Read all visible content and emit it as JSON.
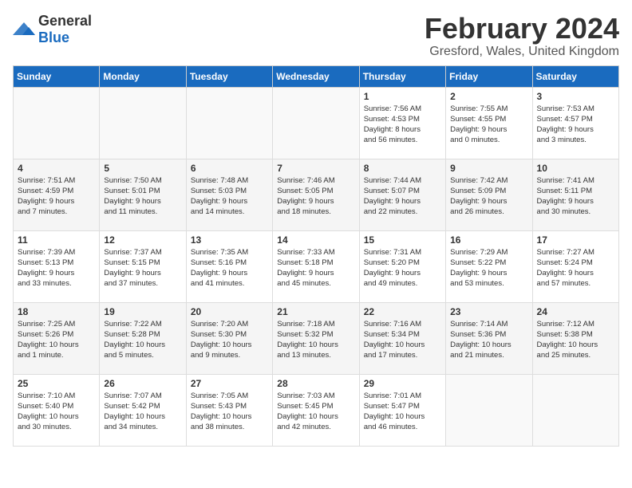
{
  "logo": {
    "general": "General",
    "blue": "Blue"
  },
  "title": "February 2024",
  "location": "Gresford, Wales, United Kingdom",
  "headers": [
    "Sunday",
    "Monday",
    "Tuesday",
    "Wednesday",
    "Thursday",
    "Friday",
    "Saturday"
  ],
  "rows": [
    [
      {
        "day": "",
        "info": ""
      },
      {
        "day": "",
        "info": ""
      },
      {
        "day": "",
        "info": ""
      },
      {
        "day": "",
        "info": ""
      },
      {
        "day": "1",
        "info": "Sunrise: 7:56 AM\nSunset: 4:53 PM\nDaylight: 8 hours\nand 56 minutes."
      },
      {
        "day": "2",
        "info": "Sunrise: 7:55 AM\nSunset: 4:55 PM\nDaylight: 9 hours\nand 0 minutes."
      },
      {
        "day": "3",
        "info": "Sunrise: 7:53 AM\nSunset: 4:57 PM\nDaylight: 9 hours\nand 3 minutes."
      }
    ],
    [
      {
        "day": "4",
        "info": "Sunrise: 7:51 AM\nSunset: 4:59 PM\nDaylight: 9 hours\nand 7 minutes."
      },
      {
        "day": "5",
        "info": "Sunrise: 7:50 AM\nSunset: 5:01 PM\nDaylight: 9 hours\nand 11 minutes."
      },
      {
        "day": "6",
        "info": "Sunrise: 7:48 AM\nSunset: 5:03 PM\nDaylight: 9 hours\nand 14 minutes."
      },
      {
        "day": "7",
        "info": "Sunrise: 7:46 AM\nSunset: 5:05 PM\nDaylight: 9 hours\nand 18 minutes."
      },
      {
        "day": "8",
        "info": "Sunrise: 7:44 AM\nSunset: 5:07 PM\nDaylight: 9 hours\nand 22 minutes."
      },
      {
        "day": "9",
        "info": "Sunrise: 7:42 AM\nSunset: 5:09 PM\nDaylight: 9 hours\nand 26 minutes."
      },
      {
        "day": "10",
        "info": "Sunrise: 7:41 AM\nSunset: 5:11 PM\nDaylight: 9 hours\nand 30 minutes."
      }
    ],
    [
      {
        "day": "11",
        "info": "Sunrise: 7:39 AM\nSunset: 5:13 PM\nDaylight: 9 hours\nand 33 minutes."
      },
      {
        "day": "12",
        "info": "Sunrise: 7:37 AM\nSunset: 5:15 PM\nDaylight: 9 hours\nand 37 minutes."
      },
      {
        "day": "13",
        "info": "Sunrise: 7:35 AM\nSunset: 5:16 PM\nDaylight: 9 hours\nand 41 minutes."
      },
      {
        "day": "14",
        "info": "Sunrise: 7:33 AM\nSunset: 5:18 PM\nDaylight: 9 hours\nand 45 minutes."
      },
      {
        "day": "15",
        "info": "Sunrise: 7:31 AM\nSunset: 5:20 PM\nDaylight: 9 hours\nand 49 minutes."
      },
      {
        "day": "16",
        "info": "Sunrise: 7:29 AM\nSunset: 5:22 PM\nDaylight: 9 hours\nand 53 minutes."
      },
      {
        "day": "17",
        "info": "Sunrise: 7:27 AM\nSunset: 5:24 PM\nDaylight: 9 hours\nand 57 minutes."
      }
    ],
    [
      {
        "day": "18",
        "info": "Sunrise: 7:25 AM\nSunset: 5:26 PM\nDaylight: 10 hours\nand 1 minute."
      },
      {
        "day": "19",
        "info": "Sunrise: 7:22 AM\nSunset: 5:28 PM\nDaylight: 10 hours\nand 5 minutes."
      },
      {
        "day": "20",
        "info": "Sunrise: 7:20 AM\nSunset: 5:30 PM\nDaylight: 10 hours\nand 9 minutes."
      },
      {
        "day": "21",
        "info": "Sunrise: 7:18 AM\nSunset: 5:32 PM\nDaylight: 10 hours\nand 13 minutes."
      },
      {
        "day": "22",
        "info": "Sunrise: 7:16 AM\nSunset: 5:34 PM\nDaylight: 10 hours\nand 17 minutes."
      },
      {
        "day": "23",
        "info": "Sunrise: 7:14 AM\nSunset: 5:36 PM\nDaylight: 10 hours\nand 21 minutes."
      },
      {
        "day": "24",
        "info": "Sunrise: 7:12 AM\nSunset: 5:38 PM\nDaylight: 10 hours\nand 25 minutes."
      }
    ],
    [
      {
        "day": "25",
        "info": "Sunrise: 7:10 AM\nSunset: 5:40 PM\nDaylight: 10 hours\nand 30 minutes."
      },
      {
        "day": "26",
        "info": "Sunrise: 7:07 AM\nSunset: 5:42 PM\nDaylight: 10 hours\nand 34 minutes."
      },
      {
        "day": "27",
        "info": "Sunrise: 7:05 AM\nSunset: 5:43 PM\nDaylight: 10 hours\nand 38 minutes."
      },
      {
        "day": "28",
        "info": "Sunrise: 7:03 AM\nSunset: 5:45 PM\nDaylight: 10 hours\nand 42 minutes."
      },
      {
        "day": "29",
        "info": "Sunrise: 7:01 AM\nSunset: 5:47 PM\nDaylight: 10 hours\nand 46 minutes."
      },
      {
        "day": "",
        "info": ""
      },
      {
        "day": "",
        "info": ""
      }
    ]
  ]
}
